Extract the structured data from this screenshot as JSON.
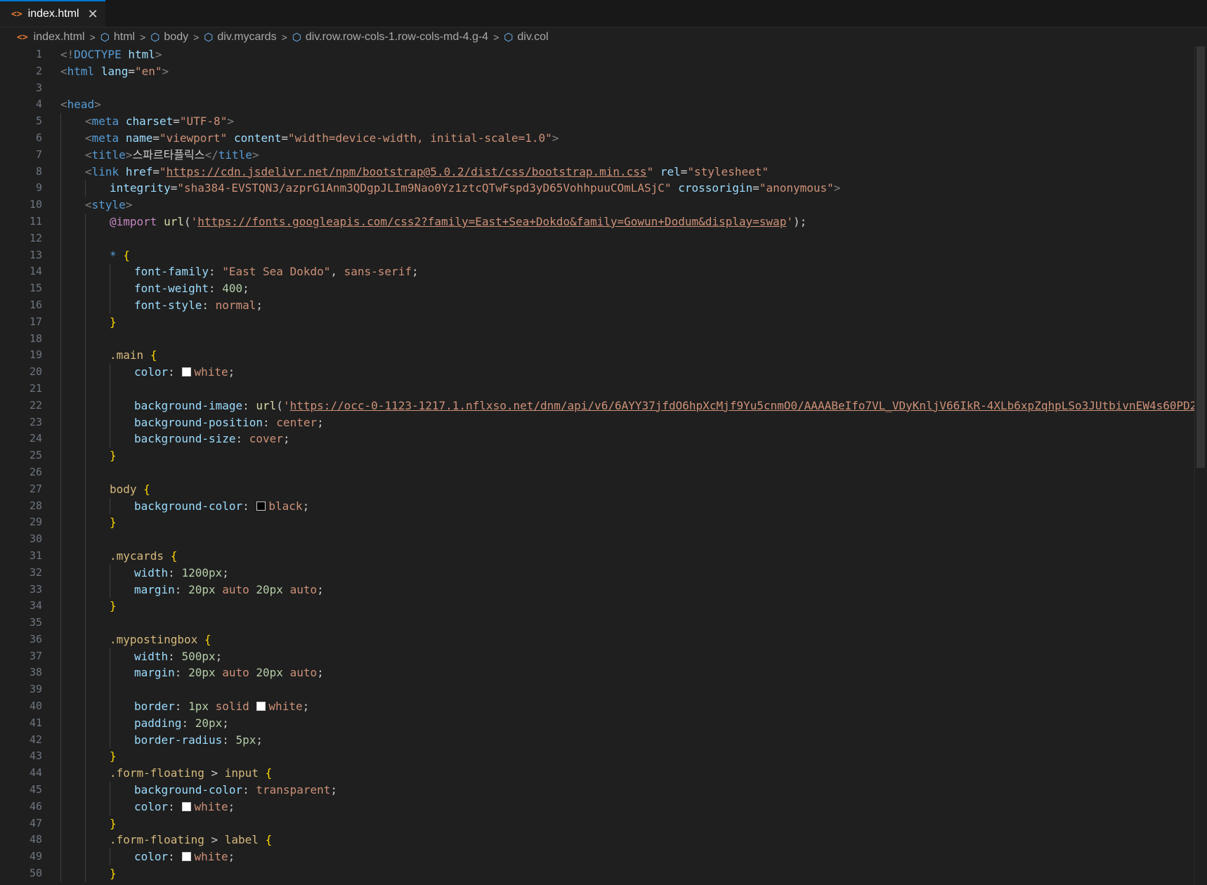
{
  "tab": {
    "label": "index.html",
    "close": "✕"
  },
  "breadcrumb": [
    "index.html",
    "html",
    "body",
    "div.mycards",
    "div.row.row-cols-1.row-cols-md-4.g-4",
    "div.col"
  ],
  "colors": {
    "accent": "#0078d4",
    "html_icon": "#e37933",
    "element_icon": "#75beff"
  },
  "line_numbers": [
    "1",
    "2",
    "3",
    "4",
    "5",
    "6",
    "7",
    "8",
    "9",
    "10",
    "11",
    "12",
    "13",
    "14",
    "15",
    "16",
    "17",
    "18",
    "19",
    "20",
    "21",
    "22",
    "23",
    "24",
    "25",
    "26",
    "27",
    "28",
    "29",
    "30",
    "31",
    "32",
    "33",
    "34",
    "35",
    "36",
    "37",
    "38",
    "39",
    "40",
    "41",
    "42",
    "43",
    "44",
    "45",
    "46",
    "47",
    "48",
    "49",
    "50"
  ],
  "code": [
    {
      "indent": 0,
      "tokens": [
        [
          "br",
          "<!"
        ],
        [
          "tag",
          "DOCTYPE"
        ],
        [
          "txt",
          " "
        ],
        [
          "attr",
          "html"
        ],
        [
          "br",
          ">"
        ]
      ]
    },
    {
      "indent": 0,
      "tokens": [
        [
          "br",
          "<"
        ],
        [
          "tag",
          "html"
        ],
        [
          "txt",
          " "
        ],
        [
          "attr",
          "lang"
        ],
        [
          "punc",
          "="
        ],
        [
          "str",
          "\"en\""
        ],
        [
          "br",
          ">"
        ]
      ]
    },
    {
      "indent": 0,
      "tokens": []
    },
    {
      "indent": 0,
      "tokens": [
        [
          "br",
          "<"
        ],
        [
          "tag",
          "head"
        ],
        [
          "br",
          ">"
        ]
      ]
    },
    {
      "indent": 1,
      "tokens": [
        [
          "br",
          "<"
        ],
        [
          "tag",
          "meta"
        ],
        [
          "txt",
          " "
        ],
        [
          "attr",
          "charset"
        ],
        [
          "punc",
          "="
        ],
        [
          "str",
          "\"UTF-8\""
        ],
        [
          "br",
          ">"
        ]
      ]
    },
    {
      "indent": 1,
      "tokens": [
        [
          "br",
          "<"
        ],
        [
          "tag",
          "meta"
        ],
        [
          "txt",
          " "
        ],
        [
          "attr",
          "name"
        ],
        [
          "punc",
          "="
        ],
        [
          "str",
          "\"viewport\""
        ],
        [
          "txt",
          " "
        ],
        [
          "attr",
          "content"
        ],
        [
          "punc",
          "="
        ],
        [
          "str",
          "\"width=device-width, initial-scale=1.0\""
        ],
        [
          "br",
          ">"
        ]
      ]
    },
    {
      "indent": 1,
      "tokens": [
        [
          "br",
          "<"
        ],
        [
          "tag",
          "title"
        ],
        [
          "br",
          ">"
        ],
        [
          "txt",
          "스파르타플릭스"
        ],
        [
          "br",
          "</"
        ],
        [
          "tag",
          "title"
        ],
        [
          "br",
          ">"
        ]
      ]
    },
    {
      "indent": 1,
      "tokens": [
        [
          "br",
          "<"
        ],
        [
          "tag",
          "link"
        ],
        [
          "txt",
          " "
        ],
        [
          "attr",
          "href"
        ],
        [
          "punc",
          "="
        ],
        [
          "str",
          "\""
        ],
        [
          "url",
          "https://cdn.jsdelivr.net/npm/bootstrap@5.0.2/dist/css/bootstrap.min.css"
        ],
        [
          "str",
          "\""
        ],
        [
          "txt",
          " "
        ],
        [
          "attr",
          "rel"
        ],
        [
          "punc",
          "="
        ],
        [
          "str",
          "\"stylesheet\""
        ]
      ]
    },
    {
      "indent": 2,
      "tokens": [
        [
          "attr",
          "integrity"
        ],
        [
          "punc",
          "="
        ],
        [
          "str",
          "\"sha384-EVSTQN3/azprG1Anm3QDgpJLIm9Nao0Yz1ztcQTwFspd3yD65VohhpuuCOmLASjC\""
        ],
        [
          "txt",
          " "
        ],
        [
          "attr",
          "crossorigin"
        ],
        [
          "punc",
          "="
        ],
        [
          "str",
          "\"anonymous\""
        ],
        [
          "br",
          ">"
        ]
      ]
    },
    {
      "indent": 1,
      "tokens": [
        [
          "br",
          "<"
        ],
        [
          "tag",
          "style"
        ],
        [
          "br",
          ">"
        ]
      ]
    },
    {
      "indent": 2,
      "tokens": [
        [
          "at",
          "@import"
        ],
        [
          "txt",
          " "
        ],
        [
          "fn",
          "url"
        ],
        [
          "punc",
          "("
        ],
        [
          "str",
          "'"
        ],
        [
          "url",
          "https://fonts.googleapis.com/css2?family=East+Sea+Dokdo&family=Gowun+Dodum&display=swap"
        ],
        [
          "str",
          "'"
        ],
        [
          "punc",
          ");"
        ]
      ]
    },
    {
      "indent": 2,
      "tokens": []
    },
    {
      "indent": 2,
      "tokens": [
        [
          "tag",
          "*"
        ],
        [
          "txt",
          " "
        ],
        [
          "brace",
          "{"
        ]
      ]
    },
    {
      "indent": 3,
      "tokens": [
        [
          "prop",
          "font-family"
        ],
        [
          "punc",
          ": "
        ],
        [
          "val",
          "\"East Sea Dokdo\""
        ],
        [
          "punc",
          ", "
        ],
        [
          "val",
          "sans-serif"
        ],
        [
          "punc",
          ";"
        ]
      ]
    },
    {
      "indent": 3,
      "tokens": [
        [
          "prop",
          "font-weight"
        ],
        [
          "punc",
          ": "
        ],
        [
          "num",
          "400"
        ],
        [
          "punc",
          ";"
        ]
      ]
    },
    {
      "indent": 3,
      "tokens": [
        [
          "prop",
          "font-style"
        ],
        [
          "punc",
          ": "
        ],
        [
          "val",
          "normal"
        ],
        [
          "punc",
          ";"
        ]
      ]
    },
    {
      "indent": 2,
      "tokens": [
        [
          "brace",
          "}"
        ]
      ]
    },
    {
      "indent": 2,
      "tokens": []
    },
    {
      "indent": 2,
      "tokens": [
        [
          "sel",
          ".main"
        ],
        [
          "txt",
          " "
        ],
        [
          "brace",
          "{"
        ]
      ]
    },
    {
      "indent": 3,
      "tokens": [
        [
          "prop",
          "color"
        ],
        [
          "punc",
          ": "
        ],
        [
          "swatch",
          "#ffffff"
        ],
        [
          "val",
          "white"
        ],
        [
          "punc",
          ";"
        ]
      ]
    },
    {
      "indent": 3,
      "tokens": []
    },
    {
      "indent": 3,
      "tokens": [
        [
          "prop",
          "background-image"
        ],
        [
          "punc",
          ": "
        ],
        [
          "fn",
          "url"
        ],
        [
          "punc",
          "("
        ],
        [
          "str",
          "'"
        ],
        [
          "url",
          "https://occ-0-1123-1217.1.nflxso.net/dnm/api/v6/6AYY37jfdO6hpXcMjf9Yu5cnmO0/AAAABeIfo7VL_VDyKnljV66IkR-4XLb6xpZqhpLSo3JUtbivnEW4s60PD27"
        ]
      ]
    },
    {
      "indent": 3,
      "tokens": [
        [
          "prop",
          "background-position"
        ],
        [
          "punc",
          ": "
        ],
        [
          "val",
          "center"
        ],
        [
          "punc",
          ";"
        ]
      ]
    },
    {
      "indent": 3,
      "tokens": [
        [
          "prop",
          "background-size"
        ],
        [
          "punc",
          ": "
        ],
        [
          "val",
          "cover"
        ],
        [
          "punc",
          ";"
        ]
      ]
    },
    {
      "indent": 2,
      "tokens": [
        [
          "brace",
          "}"
        ]
      ]
    },
    {
      "indent": 2,
      "tokens": []
    },
    {
      "indent": 2,
      "tokens": [
        [
          "sel",
          "body"
        ],
        [
          "txt",
          " "
        ],
        [
          "brace",
          "{"
        ]
      ]
    },
    {
      "indent": 3,
      "tokens": [
        [
          "prop",
          "background-color"
        ],
        [
          "punc",
          ": "
        ],
        [
          "swatch",
          "#000000"
        ],
        [
          "val",
          "black"
        ],
        [
          "punc",
          ";"
        ]
      ]
    },
    {
      "indent": 2,
      "tokens": [
        [
          "brace",
          "}"
        ]
      ]
    },
    {
      "indent": 2,
      "tokens": []
    },
    {
      "indent": 2,
      "tokens": [
        [
          "sel",
          ".mycards"
        ],
        [
          "txt",
          " "
        ],
        [
          "brace",
          "{"
        ]
      ]
    },
    {
      "indent": 3,
      "tokens": [
        [
          "prop",
          "width"
        ],
        [
          "punc",
          ": "
        ],
        [
          "num",
          "1200px"
        ],
        [
          "punc",
          ";"
        ]
      ]
    },
    {
      "indent": 3,
      "tokens": [
        [
          "prop",
          "margin"
        ],
        [
          "punc",
          ": "
        ],
        [
          "num",
          "20px"
        ],
        [
          "txt",
          " "
        ],
        [
          "val",
          "auto"
        ],
        [
          "txt",
          " "
        ],
        [
          "num",
          "20px"
        ],
        [
          "txt",
          " "
        ],
        [
          "val",
          "auto"
        ],
        [
          "punc",
          ";"
        ]
      ]
    },
    {
      "indent": 2,
      "tokens": [
        [
          "brace",
          "}"
        ]
      ]
    },
    {
      "indent": 2,
      "tokens": []
    },
    {
      "indent": 2,
      "tokens": [
        [
          "sel",
          ".mypostingbox"
        ],
        [
          "txt",
          " "
        ],
        [
          "brace",
          "{"
        ]
      ]
    },
    {
      "indent": 3,
      "tokens": [
        [
          "prop",
          "width"
        ],
        [
          "punc",
          ": "
        ],
        [
          "num",
          "500px"
        ],
        [
          "punc",
          ";"
        ]
      ]
    },
    {
      "indent": 3,
      "tokens": [
        [
          "prop",
          "margin"
        ],
        [
          "punc",
          ": "
        ],
        [
          "num",
          "20px"
        ],
        [
          "txt",
          " "
        ],
        [
          "val",
          "auto"
        ],
        [
          "txt",
          " "
        ],
        [
          "num",
          "20px"
        ],
        [
          "txt",
          " "
        ],
        [
          "val",
          "auto"
        ],
        [
          "punc",
          ";"
        ]
      ]
    },
    {
      "indent": 3,
      "tokens": []
    },
    {
      "indent": 3,
      "tokens": [
        [
          "prop",
          "border"
        ],
        [
          "punc",
          ": "
        ],
        [
          "num",
          "1px"
        ],
        [
          "txt",
          " "
        ],
        [
          "val",
          "solid"
        ],
        [
          "txt",
          " "
        ],
        [
          "swatch",
          "#ffffff"
        ],
        [
          "val",
          "white"
        ],
        [
          "punc",
          ";"
        ]
      ]
    },
    {
      "indent": 3,
      "tokens": [
        [
          "prop",
          "padding"
        ],
        [
          "punc",
          ": "
        ],
        [
          "num",
          "20px"
        ],
        [
          "punc",
          ";"
        ]
      ]
    },
    {
      "indent": 3,
      "tokens": [
        [
          "prop",
          "border-radius"
        ],
        [
          "punc",
          ": "
        ],
        [
          "num",
          "5px"
        ],
        [
          "punc",
          ";"
        ]
      ]
    },
    {
      "indent": 2,
      "tokens": [
        [
          "brace",
          "}"
        ]
      ]
    },
    {
      "indent": 2,
      "tokens": [
        [
          "sel",
          ".form-floating"
        ],
        [
          "txt",
          " "
        ],
        [
          "punc",
          ">"
        ],
        [
          "txt",
          " "
        ],
        [
          "sel",
          "input"
        ],
        [
          "txt",
          " "
        ],
        [
          "brace",
          "{"
        ]
      ]
    },
    {
      "indent": 3,
      "tokens": [
        [
          "prop",
          "background-color"
        ],
        [
          "punc",
          ": "
        ],
        [
          "val",
          "transparent"
        ],
        [
          "punc",
          ";"
        ]
      ]
    },
    {
      "indent": 3,
      "tokens": [
        [
          "prop",
          "color"
        ],
        [
          "punc",
          ": "
        ],
        [
          "swatch",
          "#ffffff"
        ],
        [
          "val",
          "white"
        ],
        [
          "punc",
          ";"
        ]
      ]
    },
    {
      "indent": 2,
      "tokens": [
        [
          "brace",
          "}"
        ]
      ]
    },
    {
      "indent": 2,
      "tokens": [
        [
          "sel",
          ".form-floating"
        ],
        [
          "txt",
          " "
        ],
        [
          "punc",
          ">"
        ],
        [
          "txt",
          " "
        ],
        [
          "sel",
          "label"
        ],
        [
          "txt",
          " "
        ],
        [
          "brace",
          "{"
        ]
      ]
    },
    {
      "indent": 3,
      "tokens": [
        [
          "prop",
          "color"
        ],
        [
          "punc",
          ": "
        ],
        [
          "swatch",
          "#ffffff"
        ],
        [
          "val",
          "white"
        ],
        [
          "punc",
          ";"
        ]
      ]
    },
    {
      "indent": 2,
      "tokens": [
        [
          "brace",
          "}"
        ]
      ]
    }
  ]
}
